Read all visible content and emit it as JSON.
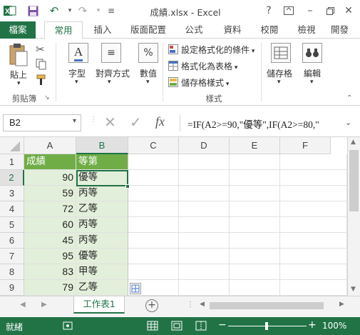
{
  "window": {
    "title": "成績.xlsx - Excel"
  },
  "icons": {
    "excel": "excel-logo-icon",
    "save": "save-icon",
    "undo": "undo-icon",
    "redo": "redo-icon",
    "help": "help-icon"
  },
  "tabs": [
    {
      "label": "檔案"
    },
    {
      "label": "常用"
    },
    {
      "label": "插入"
    },
    {
      "label": "版面配置"
    },
    {
      "label": "公式"
    },
    {
      "label": "資料"
    },
    {
      "label": "校閱"
    },
    {
      "label": "檢視"
    },
    {
      "label": "開發"
    }
  ],
  "ribbon": {
    "clipboard": {
      "paste": "貼上",
      "group": "剪貼簿"
    },
    "font": {
      "label": "字型"
    },
    "alignment": {
      "label": "對齊方式"
    },
    "number": {
      "label": "數值"
    },
    "styles": {
      "conditional": "設定格式化的條件",
      "format_table": "格式化為表格",
      "cell_styles": "儲存格樣式",
      "group": "樣式"
    },
    "cells": {
      "label": "儲存格"
    },
    "editing": {
      "label": "編輯"
    }
  },
  "formula_bar": {
    "name_box": "B2",
    "formula": "=IF(A2>=90,\"優等\",IF(A2>=80,\"",
    "fx": "fx"
  },
  "grid": {
    "columns": [
      "A",
      "B",
      "C",
      "D",
      "E",
      "F"
    ],
    "rows": [
      "1",
      "2",
      "3",
      "4",
      "5",
      "6",
      "7",
      "8",
      "9"
    ],
    "header": [
      "成績",
      "等第"
    ],
    "data": [
      [
        "90",
        "優等"
      ],
      [
        "59",
        "丙等"
      ],
      [
        "72",
        "乙等"
      ],
      [
        "60",
        "丙等"
      ],
      [
        "45",
        "丙等"
      ],
      [
        "95",
        "優等"
      ],
      [
        "83",
        "甲等"
      ],
      [
        "79",
        "乙等"
      ]
    ],
    "selected_cell": "B2"
  },
  "sheet": {
    "tab": "工作表1"
  },
  "status": {
    "mode": "就緒",
    "zoom": "100%"
  },
  "colors": {
    "accent": "#217346",
    "table_header": "#70ad47",
    "table_row": "#e2efda"
  }
}
